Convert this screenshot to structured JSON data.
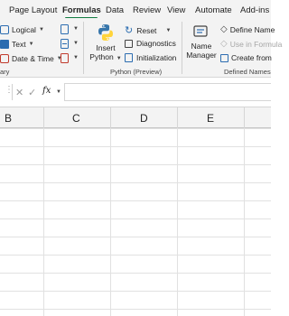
{
  "tabs": [
    {
      "label": "Page Layout",
      "active": false
    },
    {
      "label": "Formulas",
      "active": true
    },
    {
      "label": "Data",
      "active": false
    },
    {
      "label": "Review",
      "active": false
    },
    {
      "label": "View",
      "active": false
    },
    {
      "label": "Automate",
      "active": false
    },
    {
      "label": "Add-ins",
      "active": false
    }
  ],
  "ribbon": {
    "function_library": {
      "logical": "Logical",
      "text": "Text",
      "date_time": "Date & Time",
      "group_label": "ary"
    },
    "python": {
      "insert_line1": "Insert",
      "insert_line2": "Python",
      "reset": "Reset",
      "diagnostics": "Diagnostics",
      "initialization": "Initialization",
      "group_label": "Python (Preview)"
    },
    "defined_names": {
      "name_manager_line1": "Name",
      "name_manager_line2": "Manager",
      "define_name": "Define Name",
      "use_in_formula": "Use in Formula",
      "create_from": "Create from",
      "group_label": "Defined Names"
    }
  },
  "formula_bar": {
    "fx": "fx",
    "value": ""
  },
  "columns": [
    "B",
    "C",
    "D",
    "E"
  ],
  "colors": {
    "accent": "#107c41",
    "python_blue": "#3776ab",
    "python_yellow": "#ffd43b"
  }
}
